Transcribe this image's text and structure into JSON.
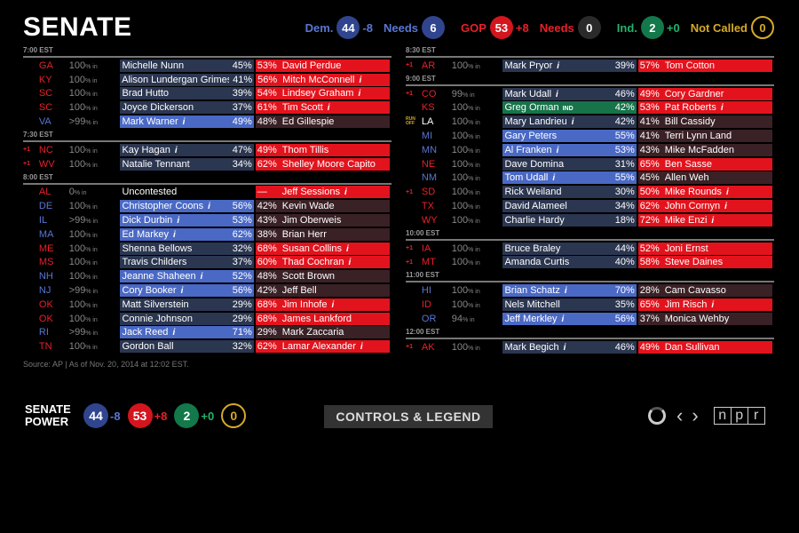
{
  "title": "SENATE",
  "summary": {
    "dem_label": "Dem.",
    "dem_seats": "44",
    "dem_change": "-8",
    "dem_needs_label": "Needs",
    "dem_needs": "6",
    "gop_label": "GOP",
    "gop_seats": "53",
    "gop_change": "+8",
    "gop_needs_label": "Needs",
    "gop_needs": "0",
    "ind_label": "Ind.",
    "ind_seats": "2",
    "ind_change": "+0",
    "notcalled_label": "Not Called",
    "notcalled": "0"
  },
  "colors": {
    "dem": "#30458e",
    "gop": "#d4151e",
    "ind": "#13784a",
    "undecided": "#d6a92b"
  },
  "left_groups": [
    {
      "time": "7:00 EST",
      "races": [
        {
          "state": "GA",
          "party": "R",
          "gain": "",
          "reporting": "100",
          "dem": "Michelle Nunn",
          "dem_pct": "45%",
          "rep": "David Perdue",
          "rep_pct": "53%",
          "winner": "R",
          "dem_info": false,
          "rep_info": false
        },
        {
          "state": "KY",
          "party": "R",
          "gain": "",
          "reporting": "100",
          "dem": "Alison Lundergan Grimes",
          "dem_pct": "41%",
          "rep": "Mitch McConnell",
          "rep_pct": "56%",
          "winner": "R",
          "dem_info": false,
          "rep_info": true
        },
        {
          "state": "SC",
          "party": "R",
          "gain": "",
          "reporting": "100",
          "dem": "Brad Hutto",
          "dem_pct": "39%",
          "rep": "Lindsey Graham",
          "rep_pct": "54%",
          "winner": "R",
          "dem_info": false,
          "rep_info": true
        },
        {
          "state": "SC",
          "party": "R",
          "gain": "",
          "reporting": "100",
          "dem": "Joyce Dickerson",
          "dem_pct": "37%",
          "rep": "Tim Scott",
          "rep_pct": "61%",
          "winner": "R",
          "dem_info": false,
          "rep_info": true
        },
        {
          "state": "VA",
          "party": "D",
          "gain": "",
          "reporting": ">99",
          "dem": "Mark Warner",
          "dem_pct": "49%",
          "rep": "Ed Gillespie",
          "rep_pct": "48%",
          "winner": "D",
          "dem_info": true,
          "rep_info": false
        }
      ]
    },
    {
      "time": "7:30 EST",
      "races": [
        {
          "state": "NC",
          "party": "R",
          "gain": "+1",
          "reporting": "100",
          "dem": "Kay Hagan",
          "dem_pct": "47%",
          "rep": "Thom Tillis",
          "rep_pct": "49%",
          "winner": "R",
          "dem_info": true,
          "rep_info": false
        },
        {
          "state": "WV",
          "party": "R",
          "gain": "+1",
          "reporting": "100",
          "dem": "Natalie Tennant",
          "dem_pct": "34%",
          "rep": "Shelley Moore Capito",
          "rep_pct": "62%",
          "winner": "R",
          "dem_info": false,
          "rep_info": false
        }
      ]
    },
    {
      "time": "8:00 EST",
      "races": [
        {
          "state": "AL",
          "party": "R",
          "gain": "",
          "reporting": "0",
          "dem": "Uncontested",
          "dem_pct": "",
          "rep": "Jeff Sessions",
          "rep_pct": "—",
          "winner": "R",
          "uncontested": true,
          "dem_info": false,
          "rep_info": true
        },
        {
          "state": "DE",
          "party": "D",
          "gain": "",
          "reporting": "100",
          "dem": "Christopher Coons",
          "dem_pct": "56%",
          "rep": "Kevin Wade",
          "rep_pct": "42%",
          "winner": "D",
          "dem_info": true,
          "rep_info": false
        },
        {
          "state": "IL",
          "party": "D",
          "gain": "",
          "reporting": ">99",
          "dem": "Dick Durbin",
          "dem_pct": "53%",
          "rep": "Jim Oberweis",
          "rep_pct": "43%",
          "winner": "D",
          "dem_info": true,
          "rep_info": false
        },
        {
          "state": "MA",
          "party": "D",
          "gain": "",
          "reporting": "100",
          "dem": "Ed Markey",
          "dem_pct": "62%",
          "rep": "Brian Herr",
          "rep_pct": "38%",
          "winner": "D",
          "dem_info": true,
          "rep_info": false
        },
        {
          "state": "ME",
          "party": "R",
          "gain": "",
          "reporting": "100",
          "dem": "Shenna Bellows",
          "dem_pct": "32%",
          "rep": "Susan Collins",
          "rep_pct": "68%",
          "winner": "R",
          "dem_info": false,
          "rep_info": true
        },
        {
          "state": "MS",
          "party": "R",
          "gain": "",
          "reporting": "100",
          "dem": "Travis Childers",
          "dem_pct": "37%",
          "rep": "Thad Cochran",
          "rep_pct": "60%",
          "winner": "R",
          "dem_info": false,
          "rep_info": true
        },
        {
          "state": "NH",
          "party": "D",
          "gain": "",
          "reporting": "100",
          "dem": "Jeanne Shaheen",
          "dem_pct": "52%",
          "rep": "Scott Brown",
          "rep_pct": "48%",
          "winner": "D",
          "dem_info": true,
          "rep_info": false
        },
        {
          "state": "NJ",
          "party": "D",
          "gain": "",
          "reporting": ">99",
          "dem": "Cory Booker",
          "dem_pct": "56%",
          "rep": "Jeff Bell",
          "rep_pct": "42%",
          "winner": "D",
          "dem_info": true,
          "rep_info": false
        },
        {
          "state": "OK",
          "party": "R",
          "gain": "",
          "reporting": "100",
          "dem": "Matt Silverstein",
          "dem_pct": "29%",
          "rep": "Jim Inhofe",
          "rep_pct": "68%",
          "winner": "R",
          "dem_info": false,
          "rep_info": true
        },
        {
          "state": "OK",
          "party": "R",
          "gain": "",
          "reporting": "100",
          "dem": "Connie Johnson",
          "dem_pct": "29%",
          "rep": "James Lankford",
          "rep_pct": "68%",
          "winner": "R",
          "dem_info": false,
          "rep_info": false
        },
        {
          "state": "RI",
          "party": "D",
          "gain": "",
          "reporting": ">99",
          "dem": "Jack Reed",
          "dem_pct": "71%",
          "rep": "Mark Zaccaria",
          "rep_pct": "29%",
          "winner": "D",
          "dem_info": true,
          "rep_info": false
        },
        {
          "state": "TN",
          "party": "R",
          "gain": "",
          "reporting": "100",
          "dem": "Gordon Ball",
          "dem_pct": "32%",
          "rep": "Lamar Alexander",
          "rep_pct": "62%",
          "winner": "R",
          "dem_info": false,
          "rep_info": true
        }
      ]
    }
  ],
  "right_groups": [
    {
      "time": "8:30 EST",
      "races": [
        {
          "state": "AR",
          "party": "R",
          "gain": "+1",
          "reporting": "100",
          "dem": "Mark Pryor",
          "dem_pct": "39%",
          "rep": "Tom Cotton",
          "rep_pct": "57%",
          "winner": "R",
          "dem_info": true,
          "rep_info": false
        }
      ]
    },
    {
      "time": "9:00 EST",
      "races": [
        {
          "state": "CO",
          "party": "R",
          "gain": "+1",
          "reporting": "99",
          "dem": "Mark Udall",
          "dem_pct": "46%",
          "rep": "Cory Gardner",
          "rep_pct": "49%",
          "winner": "R",
          "dem_info": true,
          "rep_info": false
        },
        {
          "state": "KS",
          "party": "R",
          "gain": "",
          "reporting": "100",
          "dem": "Greg Orman",
          "dem_tag": "IND",
          "dem_pct": "42%",
          "rep": "Pat Roberts",
          "rep_pct": "53%",
          "winner": "R",
          "ind": true,
          "dem_info": false,
          "rep_info": true
        },
        {
          "state": "LA",
          "party": "X",
          "gain": "RUN OFF",
          "reporting": "100",
          "dem": "Mary Landrieu",
          "dem_pct": "42%",
          "rep": "Bill Cassidy",
          "rep_pct": "41%",
          "winner": "",
          "dem_info": true,
          "rep_info": false
        },
        {
          "state": "MI",
          "party": "D",
          "gain": "",
          "reporting": "100",
          "dem": "Gary Peters",
          "dem_pct": "55%",
          "rep": "Terri Lynn Land",
          "rep_pct": "41%",
          "winner": "D",
          "dem_info": false,
          "rep_info": false
        },
        {
          "state": "MN",
          "party": "D",
          "gain": "",
          "reporting": "100",
          "dem": "Al Franken",
          "dem_pct": "53%",
          "rep": "Mike McFadden",
          "rep_pct": "43%",
          "winner": "D",
          "dem_info": true,
          "rep_info": false
        },
        {
          "state": "NE",
          "party": "R",
          "gain": "",
          "reporting": "100",
          "dem": "Dave Domina",
          "dem_pct": "31%",
          "rep": "Ben Sasse",
          "rep_pct": "65%",
          "winner": "R",
          "dem_info": false,
          "rep_info": false
        },
        {
          "state": "NM",
          "party": "D",
          "gain": "",
          "reporting": "100",
          "dem": "Tom Udall",
          "dem_pct": "55%",
          "rep": "Allen Weh",
          "rep_pct": "45%",
          "winner": "D",
          "dem_info": true,
          "rep_info": false
        },
        {
          "state": "SD",
          "party": "R",
          "gain": "+1",
          "reporting": "100",
          "dem": "Rick Weiland",
          "dem_pct": "30%",
          "rep": "Mike Rounds",
          "rep_pct": "50%",
          "winner": "R",
          "dem_info": false,
          "rep_info": true
        },
        {
          "state": "TX",
          "party": "R",
          "gain": "",
          "reporting": "100",
          "dem": "David Alameel",
          "dem_pct": "34%",
          "rep": "John Cornyn",
          "rep_pct": "62%",
          "winner": "R",
          "dem_info": false,
          "rep_info": true
        },
        {
          "state": "WY",
          "party": "R",
          "gain": "",
          "reporting": "100",
          "dem": "Charlie Hardy",
          "dem_pct": "18%",
          "rep": "Mike Enzi",
          "rep_pct": "72%",
          "winner": "R",
          "dem_info": false,
          "rep_info": true
        }
      ]
    },
    {
      "time": "10:00 EST",
      "races": [
        {
          "state": "IA",
          "party": "R",
          "gain": "+1",
          "reporting": "100",
          "dem": "Bruce Braley",
          "dem_pct": "44%",
          "rep": "Joni Ernst",
          "rep_pct": "52%",
          "winner": "R",
          "dem_info": false,
          "rep_info": false
        },
        {
          "state": "MT",
          "party": "R",
          "gain": "+1",
          "reporting": "100",
          "dem": "Amanda Curtis",
          "dem_pct": "40%",
          "rep": "Steve Daines",
          "rep_pct": "58%",
          "winner": "R",
          "dem_info": false,
          "rep_info": false
        }
      ]
    },
    {
      "time": "11:00 EST",
      "races": [
        {
          "state": "HI",
          "party": "D",
          "gain": "",
          "reporting": "100",
          "dem": "Brian Schatz",
          "dem_pct": "70%",
          "rep": "Cam Cavasso",
          "rep_pct": "28%",
          "winner": "D",
          "dem_info": true,
          "rep_info": false
        },
        {
          "state": "ID",
          "party": "R",
          "gain": "",
          "reporting": "100",
          "dem": "Nels Mitchell",
          "dem_pct": "35%",
          "rep": "Jim Risch",
          "rep_pct": "65%",
          "winner": "R",
          "dem_info": false,
          "rep_info": true
        },
        {
          "state": "OR",
          "party": "D",
          "gain": "",
          "reporting": "94",
          "dem": "Jeff Merkley",
          "dem_pct": "56%",
          "rep": "Monica Wehby",
          "rep_pct": "37%",
          "winner": "D",
          "dem_info": true,
          "rep_info": false
        }
      ]
    },
    {
      "time": "12:00 EST",
      "races": [
        {
          "state": "AK",
          "party": "R",
          "gain": "+1",
          "reporting": "100",
          "dem": "Mark Begich",
          "dem_pct": "46%",
          "rep": "Dan Sullivan",
          "rep_pct": "49%",
          "winner": "R",
          "dem_info": true,
          "rep_info": false
        }
      ]
    }
  ],
  "reporting_suffix": "% in",
  "source": "Source: AP  |  As of Nov. 20, 2014 at 12:02 EST.",
  "footer": {
    "power_label_1": "SENATE",
    "power_label_2": "POWER",
    "dem_seats": "44",
    "dem_change": "-8",
    "gop_seats": "53",
    "gop_change": "+8",
    "ind_seats": "2",
    "ind_change": "+0",
    "undecided": "0",
    "controls_label": "CONTROLS & LEGEND",
    "prev_icon": "chevron-left-icon",
    "next_icon": "chevron-right-icon",
    "logo_letters": [
      "n",
      "p",
      "r"
    ]
  }
}
